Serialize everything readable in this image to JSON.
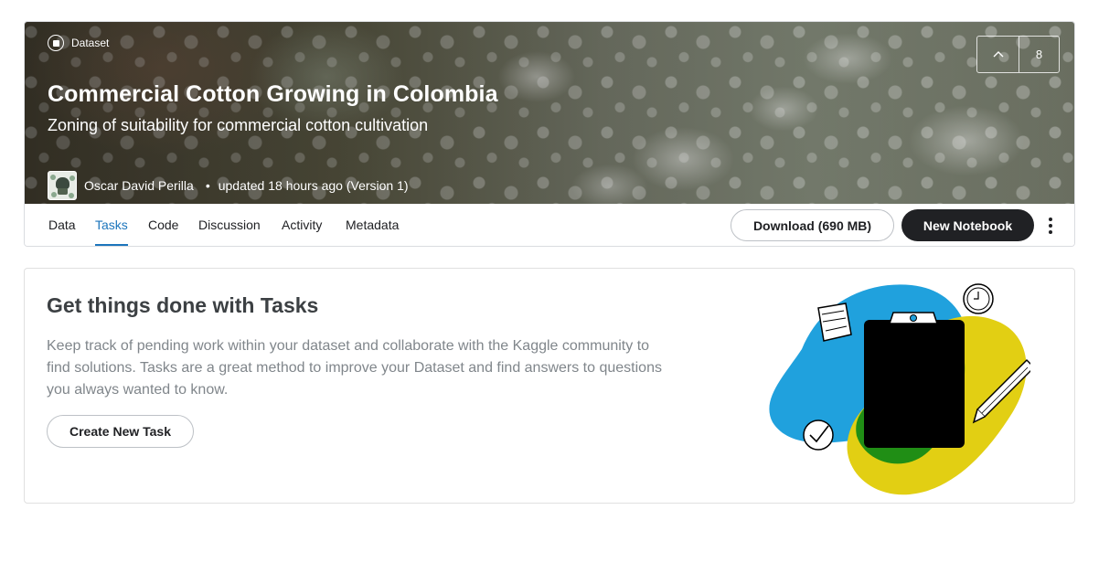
{
  "header": {
    "type_label": "Dataset",
    "title": "Commercial Cotton Growing in Colombia",
    "subtitle": "Zoning of suitability for commercial cotton cultivation",
    "owner_name": "Oscar David Perilla",
    "separator": "•",
    "updated_text": "updated 18 hours ago (Version 1)",
    "vote_count": "8",
    "icons": {
      "type": "dataset-icon",
      "vote": "chevron-up-icon",
      "avatar": "skull-avatar"
    }
  },
  "tabs": [
    {
      "label": "Data",
      "active": false
    },
    {
      "label": "Tasks",
      "active": true
    },
    {
      "label": "Code",
      "active": false
    },
    {
      "label": "Discussion",
      "active": false
    },
    {
      "label": "Activity",
      "active": false
    },
    {
      "label": "Metadata",
      "active": false
    }
  ],
  "actions": {
    "download_label": "Download (690 MB)",
    "new_notebook_label": "New Notebook",
    "more_icon": "more-vertical-icon"
  },
  "tasks": {
    "heading": "Get things done with Tasks",
    "description": "Keep track of pending work within your dataset and collaborate with the Kaggle community to find solutions. Tasks are a great method to improve your Dataset and find answers to questions you always wanted to know.",
    "create_label": "Create New Task",
    "illustration": "clipboard-tasks-illustration"
  },
  "colors": {
    "accent": "#1c75bc",
    "dark_button": "#202124",
    "illustration_blue": "#20a1dd",
    "illustration_green": "#208e15",
    "illustration_yellow": "#e2cf13"
  }
}
